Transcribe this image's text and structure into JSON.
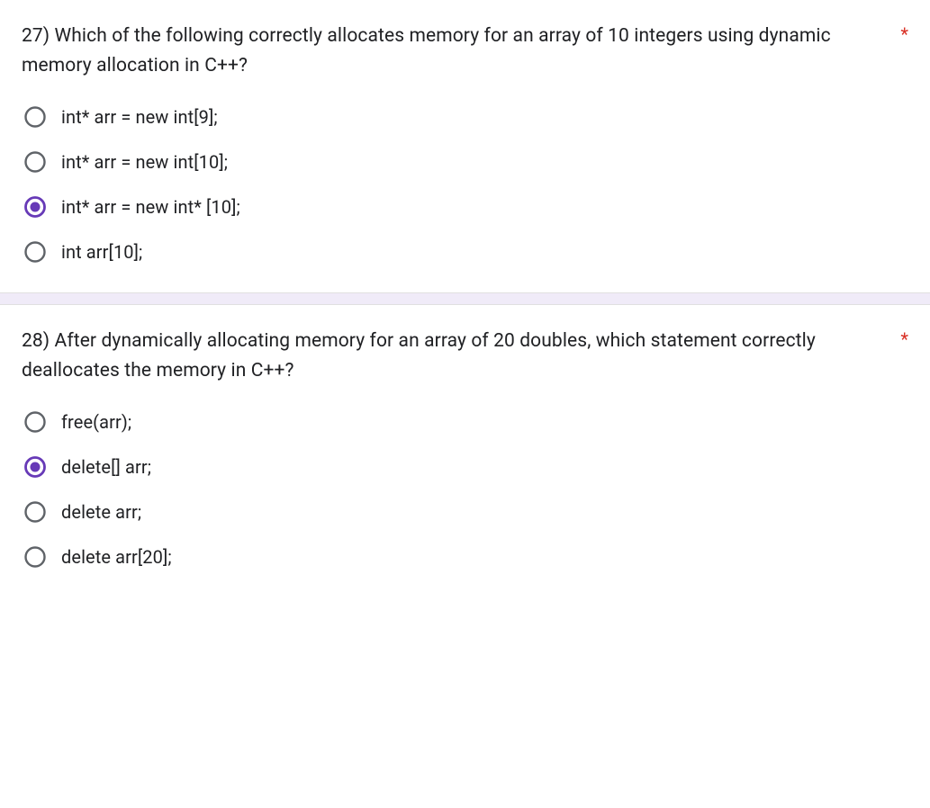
{
  "required_marker": "*",
  "questions": [
    {
      "number": "27)",
      "text": "Which of the following correctly allocates memory for an array of 10 integers using dynamic memory allocation in C++?",
      "required": true,
      "selected_index": 2,
      "options": [
        "int* arr = new int[9];",
        "int* arr = new int[10];",
        "int* arr = new int* [10];",
        "int arr[10];"
      ]
    },
    {
      "number": "28)",
      "text": "After dynamically allocating memory for an array of 20 doubles, which statement correctly deallocates the memory in C++?",
      "required": true,
      "selected_index": 1,
      "options": [
        "free(arr);",
        "delete[] arr;",
        "delete arr;",
        "delete arr[20];"
      ]
    }
  ]
}
